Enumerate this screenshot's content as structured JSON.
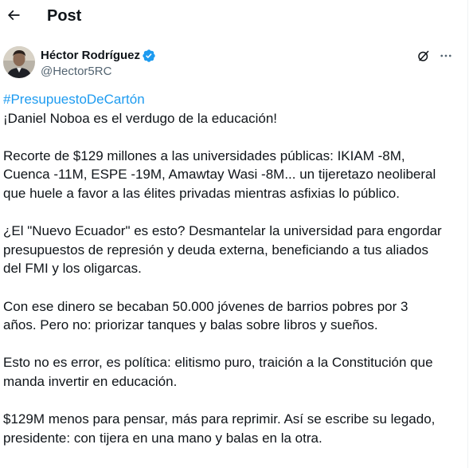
{
  "header": {
    "title": "Post"
  },
  "author": {
    "name": "Héctor Rodríguez",
    "handle": "@Hector5RC"
  },
  "colors": {
    "accent": "#1d9bf0",
    "text": "#0f1419",
    "secondary": "#536471"
  },
  "icons": {
    "back": "arrow-left-icon",
    "verified": "verified-badge-icon",
    "grok": "grok-icon",
    "more": "more-horizontal-icon"
  },
  "tweet": {
    "hashtag": "#PresupuestoDeCartón",
    "lines": [
      "¡Daniel Noboa es el verdugo de la educación!",
      "",
      "Recorte de $129 millones a las universidades públicas: IKIAM -8M,",
      "Cuenca -11M, ESPE -19M, Amawtay Wasi -8M... un tijeretazo neoliberal",
      "que huele a favor a las élites privadas mientras asfixias lo público.",
      "",
      "¿El \"Nuevo Ecuador\" es esto? Desmantelar la universidad para engordar",
      "presupuestos de represión y deuda externa, beneficiando a tus aliados",
      "del FMI y los oligarcas.",
      "",
      "Con ese dinero se becaban 50.000 jóvenes de barrios pobres por 3",
      "años. Pero no: priorizar tanques y balas sobre libros y sueños.",
      "",
      "Esto no es error, es política: elitismo puro, traición a la Constitución que",
      "manda invertir en educación.",
      "",
      "$129M menos para pensar, más para reprimir.  Así se escribe su legado,",
      "presidente: con tijera en una mano y balas en la otra."
    ]
  }
}
